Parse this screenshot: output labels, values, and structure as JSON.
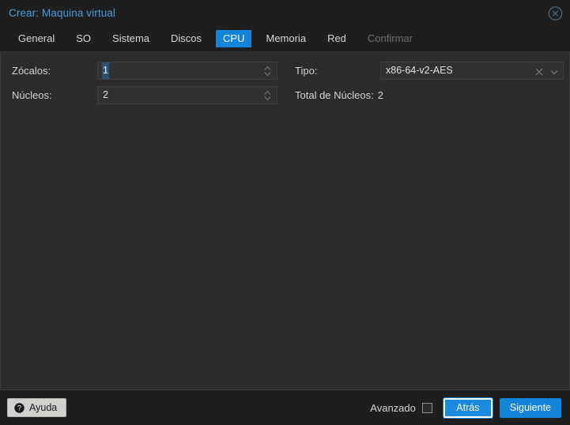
{
  "window": {
    "title": "Crear: Maquina virtual",
    "close_icon": "close-circle-icon"
  },
  "tabs": [
    {
      "label": "General",
      "state": "normal"
    },
    {
      "label": "SO",
      "state": "normal"
    },
    {
      "label": "Sistema",
      "state": "normal"
    },
    {
      "label": "Discos",
      "state": "normal"
    },
    {
      "label": "CPU",
      "state": "active"
    },
    {
      "label": "Memoria",
      "state": "normal"
    },
    {
      "label": "Red",
      "state": "normal"
    },
    {
      "label": "Confirmar",
      "state": "disabled"
    }
  ],
  "form": {
    "sockets": {
      "label": "Zócalos:",
      "value": "1"
    },
    "cores": {
      "label": "Núcleos:",
      "value": "2"
    },
    "type": {
      "label": "Tipo:",
      "value": "x86-64-v2-AES",
      "clear_icon": "clear-x-icon",
      "dropdown_icon": "chevron-down-icon"
    },
    "total_cores": {
      "label": "Total de Núcleos:",
      "value": "2"
    }
  },
  "footer": {
    "help_label": "Ayuda",
    "help_icon": "question-mark-icon",
    "advanced_label": "Avanzado",
    "advanced_checked": false,
    "back_label": "Atrás",
    "next_label": "Siguiente"
  },
  "colors": {
    "accent_blue": "#1384d8",
    "title_blue": "#4e9ad4",
    "titlebar_bg": "#1e1e1e",
    "body_bg": "#2b2b2b",
    "field_bg": "#313131",
    "text": "#d3d3d3",
    "disabled_text": "#6c6c6c",
    "help_btn_bg": "#d2d0cd"
  }
}
